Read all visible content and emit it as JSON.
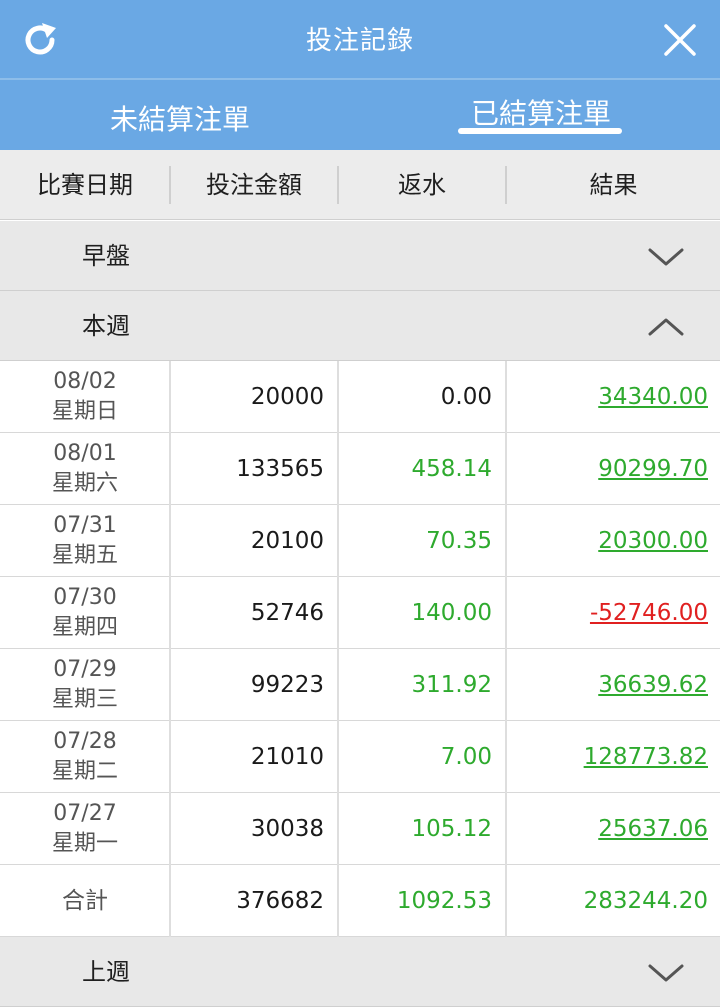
{
  "header": {
    "title": "投注記錄",
    "tabs": [
      "未結算注單",
      "已結算注單"
    ],
    "active_tab": 1,
    "accent": "#6aa8e4"
  },
  "columns": [
    "比賽日期",
    "投注金額",
    "返水",
    "結果"
  ],
  "sections": {
    "early": "早盤",
    "this_week": "本週",
    "last_week": "上週"
  },
  "rows": [
    {
      "date": "08/02",
      "weekday": "星期日",
      "amount": "20000",
      "rebate": "0.00",
      "result": "34340.00"
    },
    {
      "date": "08/01",
      "weekday": "星期六",
      "amount": "133565",
      "rebate": "458.14",
      "result": "90299.70"
    },
    {
      "date": "07/31",
      "weekday": "星期五",
      "amount": "20100",
      "rebate": "70.35",
      "result": "20300.00"
    },
    {
      "date": "07/30",
      "weekday": "星期四",
      "amount": "52746",
      "rebate": "140.00",
      "result": "-52746.00"
    },
    {
      "date": "07/29",
      "weekday": "星期三",
      "amount": "99223",
      "rebate": "311.92",
      "result": "36639.62"
    },
    {
      "date": "07/28",
      "weekday": "星期二",
      "amount": "21010",
      "rebate": "7.00",
      "result": "128773.82"
    },
    {
      "date": "07/27",
      "weekday": "星期一",
      "amount": "30038",
      "rebate": "105.12",
      "result": "25637.06"
    }
  ],
  "total": {
    "label": "合計",
    "amount": "376682",
    "rebate": "1092.53",
    "result": "283244.20"
  },
  "colors": {
    "positive": "#2eaa2e",
    "negative": "#e02020",
    "neutral": "#1a1a1a"
  },
  "icons": {
    "refresh": "refresh-icon",
    "close": "close-icon",
    "expand": "chevron-down-icon",
    "collapse": "chevron-up-icon"
  }
}
